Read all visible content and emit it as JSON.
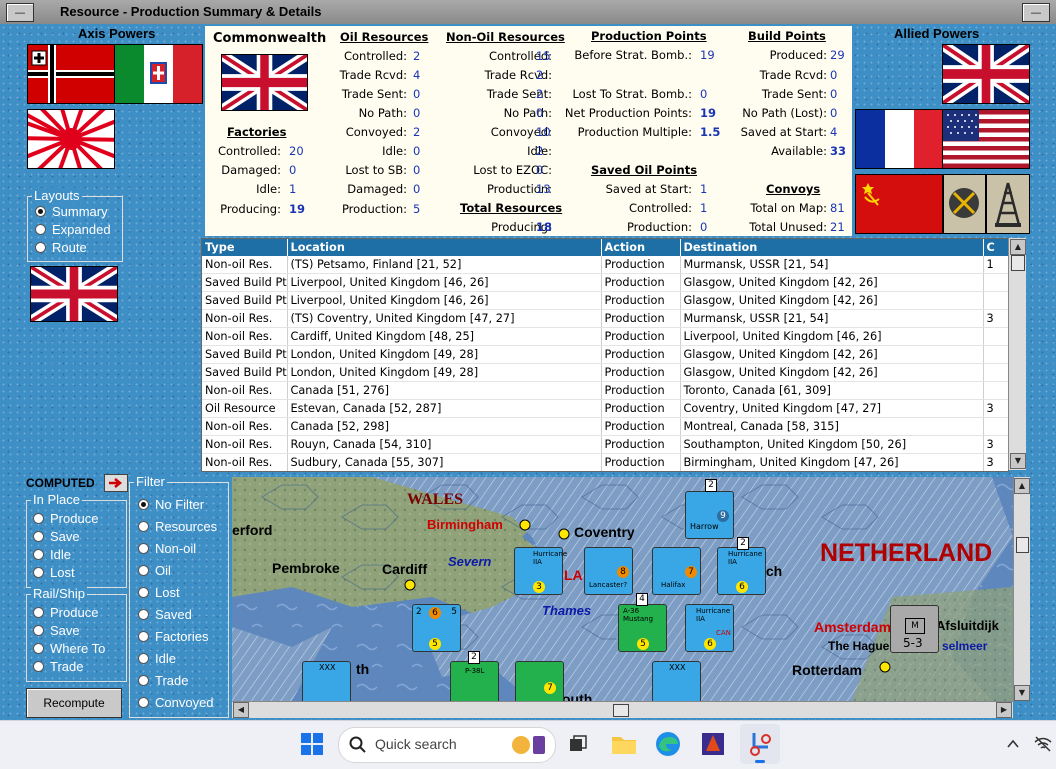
{
  "window": {
    "title": "Resource - Production Summary & Details"
  },
  "axis_title": "Axis Powers",
  "allied_title": "Allied Powers",
  "layouts": {
    "label": "Layouts",
    "options": [
      "Summary",
      "Expanded",
      "Route"
    ],
    "selected": "Summary"
  },
  "summary": {
    "country": "Commonwealth",
    "factories": {
      "title": "Factories",
      "rows": [
        {
          "label": "Controlled:",
          "value": "20"
        },
        {
          "label": "Damaged:",
          "value": "0"
        },
        {
          "label": "Idle:",
          "value": "1"
        },
        {
          "label": "Producing:",
          "value": "19"
        }
      ]
    },
    "oil": {
      "title": "Oil Resources",
      "rows": [
        {
          "label": "Controlled:",
          "value": "2"
        },
        {
          "label": "Trade Rcvd:",
          "value": "4"
        },
        {
          "label": "Trade Sent:",
          "value": "0"
        },
        {
          "label": "No Path:",
          "value": "0"
        },
        {
          "label": "Convoyed:",
          "value": "2"
        },
        {
          "label": "Idle:",
          "value": "0"
        },
        {
          "label": "Lost to SB:",
          "value": "0"
        },
        {
          "label": "Damaged:",
          "value": "0"
        },
        {
          "label": "Production:",
          "value": "5"
        }
      ]
    },
    "nonoil": {
      "title": "Non-Oil Resources",
      "rows": [
        {
          "label": "Controlled:",
          "value": "15"
        },
        {
          "label": "Trade Rcvd:",
          "value": "2"
        },
        {
          "label": "Trade Sent:",
          "value": "2"
        },
        {
          "label": "No Path:",
          "value": "0"
        },
        {
          "label": "Convoyed:",
          "value": "10"
        },
        {
          "label": "Idle:",
          "value": "2"
        },
        {
          "label": "Lost to EZOC:",
          "value": "0"
        },
        {
          "label": "Production:",
          "value": "13"
        }
      ]
    },
    "total": {
      "title": "Total Resources",
      "label": "Producing:",
      "value": "18"
    },
    "pp": {
      "title": "Production Points",
      "rows": [
        {
          "label": "Before Strat. Bomb.:",
          "value": "19"
        },
        {
          "label": "Lost To Strat. Bomb.:",
          "value": "0"
        },
        {
          "label": "Net Production Points:",
          "value": "19"
        },
        {
          "label": "Production Multiple:",
          "value": "1.5"
        }
      ]
    },
    "saved_oil": {
      "title": "Saved Oil Points",
      "rows": [
        {
          "label": "Saved at Start:",
          "value": "1"
        },
        {
          "label": "Controlled:",
          "value": "1"
        },
        {
          "label": "Production:",
          "value": "0"
        }
      ]
    },
    "build": {
      "title": "Build Points",
      "rows": [
        {
          "label": "Produced:",
          "value": "29"
        },
        {
          "label": "Trade Rcvd:",
          "value": "0"
        },
        {
          "label": "Trade Sent:",
          "value": "0"
        },
        {
          "label": "No Path (Lost):",
          "value": "0"
        },
        {
          "label": "Saved at Start:",
          "value": "4"
        },
        {
          "label": "Available:",
          "value": "33"
        }
      ]
    },
    "convoys": {
      "title": "Convoys",
      "rows": [
        {
          "label": "Total on Map:",
          "value": "81"
        },
        {
          "label": "Total Unused:",
          "value": "21"
        }
      ]
    }
  },
  "table": {
    "headers": [
      "Type",
      "Location",
      "Action",
      "Destination",
      "C"
    ],
    "rows": [
      [
        "Non-oil Res.",
        "(TS) Petsamo, Finland [21, 52]",
        "Production",
        "Murmansk, USSR [21, 54]",
        "1"
      ],
      [
        "Saved Build Pt",
        "Liverpool, United Kingdom [46, 26]",
        "Production",
        "Glasgow, United Kingdom [42, 26]",
        ""
      ],
      [
        "Saved Build Pt",
        "Liverpool, United Kingdom [46, 26]",
        "Production",
        "Glasgow, United Kingdom [42, 26]",
        ""
      ],
      [
        "Non-oil Res.",
        "(TS) Coventry, United Kingdom [47, 27]",
        "Production",
        "Murmansk, USSR [21, 54]",
        "3"
      ],
      [
        "Non-oil Res.",
        "Cardiff, United Kingdom [48, 25]",
        "Production",
        "Liverpool, United Kingdom [46, 26]",
        ""
      ],
      [
        "Saved Build Pt",
        "London, United Kingdom [49, 28]",
        "Production",
        "Glasgow, United Kingdom [42, 26]",
        ""
      ],
      [
        "Saved Build Pt",
        "London, United Kingdom [49, 28]",
        "Production",
        "Glasgow, United Kingdom [42, 26]",
        ""
      ],
      [
        "Non-oil Res.",
        "Canada [51, 276]",
        "Production",
        "Toronto, Canada [61, 309]",
        ""
      ],
      [
        "Oil Resource",
        "Estevan, Canada [52, 287]",
        "Production",
        "Coventry, United Kingdom [47, 27]",
        "3"
      ],
      [
        "Non-oil Res.",
        "Canada [52, 298]",
        "Production",
        "Montreal, Canada [58, 315]",
        ""
      ],
      [
        "Non-oil Res.",
        "Rouyn, Canada [54, 310]",
        "Production",
        "Southampton, United Kingdom [50, 26]",
        "3"
      ],
      [
        "Non-oil Res.",
        "Sudbury, Canada [55, 307]",
        "Production",
        "Birmingham, United Kingdom [47, 26]",
        "3"
      ]
    ]
  },
  "computed_label": "COMPUTED",
  "in_place": {
    "label": "In Place",
    "options": [
      "Produce",
      "Save",
      "Idle",
      "Lost"
    ]
  },
  "rail_ship": {
    "label": "Rail/Ship",
    "options": [
      "Produce",
      "Save",
      "Where To",
      "Trade"
    ]
  },
  "filter": {
    "label": "Filter",
    "options": [
      "No Filter",
      "Resources",
      "Non-oil",
      "Oil",
      "Lost",
      "Saved",
      "Factories",
      "Idle",
      "Trade",
      "Convoyed"
    ],
    "selected": "No Filter"
  },
  "recompute_label": "Recompute",
  "map": {
    "labels": [
      "WALES",
      "Birmingham",
      "Coventry",
      "erford",
      "Pembroke",
      "Cardiff",
      "Severn",
      "Thames",
      "NETHERLAND",
      "Afsluitdijk",
      "Amsterdam",
      "The Hague",
      "selmeer",
      "Rotterdam",
      "ich",
      "LA",
      "th",
      "outh"
    ],
    "units": [
      {
        "name": "Harrow",
        "top": "2",
        "bottom": "9"
      },
      {
        "name": "Hurricane IIA",
        "top": "",
        "bottom": "3"
      },
      {
        "name": "Lancaster?",
        "top": "",
        "bottom": "8"
      },
      {
        "name": "Halifax",
        "top": "",
        "bottom": "7"
      },
      {
        "name": "Hurricane IIA",
        "top": "2",
        "bottom": "6"
      },
      {
        "name": "A-36 Mustang",
        "top": "4",
        "bottom": "5"
      },
      {
        "name": "Hurricane IIA",
        "top": "",
        "bottom": "6"
      },
      {
        "name": "CAN",
        "top": "",
        "bottom": ""
      },
      {
        "name": "P-38L",
        "top": "2",
        "bottom": ""
      },
      {
        "name": "Wellington",
        "top": "",
        "bottom": "7"
      }
    ],
    "counter_5_3": "5-3",
    "counter_m": "M",
    "counter_xxx": "XXX",
    "ship_values": [
      "6",
      "5",
      "2",
      "5"
    ]
  },
  "taskbar": {
    "search_placeholder": "Quick search"
  }
}
